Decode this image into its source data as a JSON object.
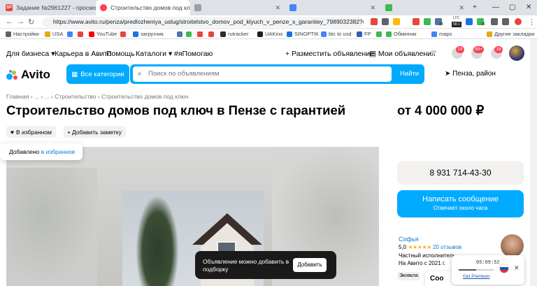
{
  "browser": {
    "tabs": [
      {
        "label": "Задание №2961227 - просмотр з",
        "favicon": "SP",
        "color": "#e8453c"
      },
      {
        "label": "Строительство домов под ключ с",
        "favicon": "",
        "color": "#ff4053"
      },
      {
        "label": "",
        "favicon": "",
        "color": "#9aa0a6"
      }
    ],
    "url": "https://www.avito.ru/penza/predlozheniya_uslug/stroitelstvo_domov_pod_klyuch_v_penze_s_garantiey_7989032382?context=...",
    "ext_badges": {
      "ltc": "LTC",
      "ltc_value": "58.1",
      "badge_33": "33",
      "badge_26": "26"
    },
    "bookmarks": [
      {
        "label": "Настройки",
        "color": "#5f6368"
      },
      {
        "label": "USA",
        "color": "#e6a817"
      },
      {
        "label": "",
        "color": "#4285f4"
      },
      {
        "label": "",
        "color": "#e8453c"
      },
      {
        "label": "YouTube",
        "color": "#ff0000"
      },
      {
        "label": "",
        "color": "#e8453c"
      },
      {
        "label": "загрузчик",
        "color": "#1a73e8"
      },
      {
        "label": "",
        "color": "#4c75a3"
      },
      {
        "label": "",
        "color": "#3cba54"
      },
      {
        "label": "",
        "color": "#e8453c"
      },
      {
        "label": "",
        "color": "#e8453c"
      },
      {
        "label": "rutracker",
        "color": "#2d2d2d"
      },
      {
        "label": "UAKino",
        "color": "#1d1d1d"
      },
      {
        "label": "SINOPTIK",
        "color": "#1a73e8"
      },
      {
        "label": "btc to usd",
        "color": "#4285f4"
      },
      {
        "label": "FP",
        "color": "#2d5fb8"
      },
      {
        "label": "",
        "color": "#3cba54"
      },
      {
        "label": "Обмінник",
        "color": "#3cba54"
      },
      {
        "label": "maps",
        "color": "#4285f4"
      },
      {
        "label": "Другие закладки",
        "color": "#e6a817"
      }
    ]
  },
  "topnav": {
    "for_business": "Для бизнеса",
    "career": "Карьера в Авито",
    "help": "Помощь",
    "catalogs": "Каталоги",
    "ipomogayu": "#яПомогаю",
    "post_ad": "+ Разместить объявление",
    "my_ads": "Мои объявления",
    "badges": {
      "bell": "14",
      "chat": "99+",
      "cart": "16"
    }
  },
  "header": {
    "logo": "Avito",
    "all_categories": "Все категории",
    "search_placeholder": "Поиск по объявлениям",
    "search_button": "Найти",
    "location": "Пенза, район"
  },
  "breadcrumb": [
    "Главная",
    "...",
    "...",
    "Строительство",
    "Строительство домов под ключ"
  ],
  "listing": {
    "title": "Строительство домов под ключ в Пензе с гарантией",
    "price": "от 4 000 000 ₽",
    "favorite": "В избранном",
    "add_note": "Добавить заметку",
    "added_toast": "Добавлено",
    "added_toast_link": "в избранное"
  },
  "fav_toast": {
    "text": "Объявление можно добавить в подборку",
    "button": "Добавить"
  },
  "sidebar": {
    "phone": "8 931 714-43-30",
    "message": "Написать сообщение",
    "reply_time": "Отвечает около часа",
    "seller_name": "Софья",
    "rating": "5,0",
    "stars": "★★★★★",
    "reviews": "20 отзывов",
    "seller_type": "Частный исполнитель",
    "since": "На Авито с 2021 г.",
    "tag": "Эковкла",
    "cut_text": "Coo"
  },
  "player": {
    "time": "05:09:52",
    "get_premium": "Get Premium",
    "progress": 0.5
  }
}
